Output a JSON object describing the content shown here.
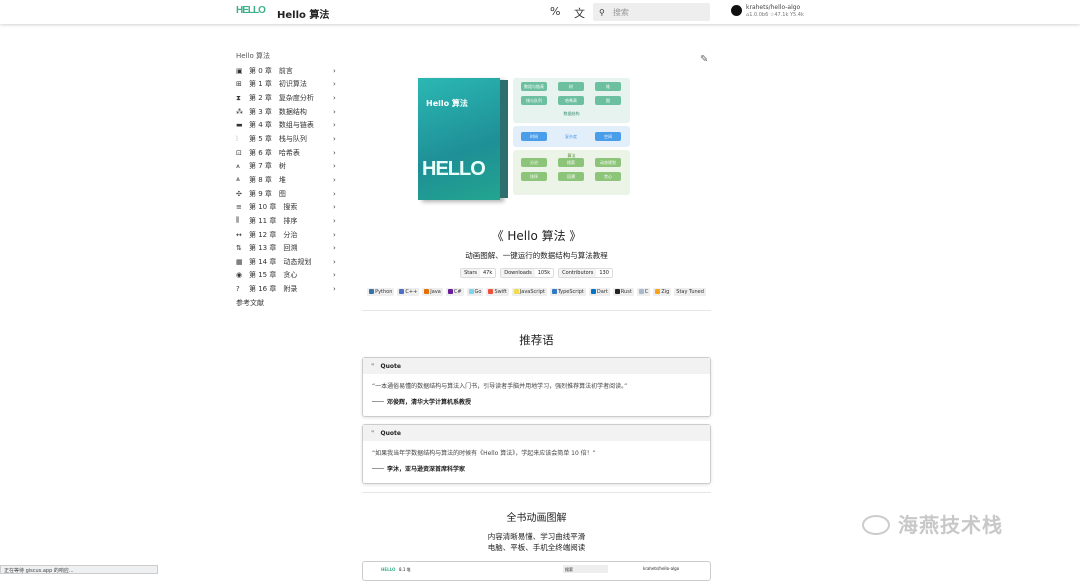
{
  "header": {
    "logo": "HELLO",
    "title": "Hello 算法",
    "search_placeholder": "搜索",
    "repo_name": "krahets/hello-algo",
    "repo_version": "1.0.0b6",
    "repo_stars": "47.1k",
    "repo_forks": "5.4k"
  },
  "sidebar": {
    "title": "Hello 算法",
    "items": [
      {
        "icon": "▣",
        "label": "第 0 章　前言"
      },
      {
        "icon": "⊞",
        "label": "第 1 章　初识算法"
      },
      {
        "icon": "⧗",
        "label": "第 2 章　复杂度分析"
      },
      {
        "icon": "⁂",
        "label": "第 3 章　数据结构"
      },
      {
        "icon": "▬",
        "label": "第 4 章　数组与链表"
      },
      {
        "icon": "⫶",
        "label": "第 5 章　栈与队列"
      },
      {
        "icon": "⊡",
        "label": "第 6 章　哈希表"
      },
      {
        "icon": "⩚",
        "label": "第 7 章　树"
      },
      {
        "icon": "⩓",
        "label": "第 8 章　堆"
      },
      {
        "icon": "✣",
        "label": "第 9 章　图"
      },
      {
        "icon": "≡",
        "label": "第 10 章　搜索"
      },
      {
        "icon": "⫼",
        "label": "第 11 章　排序"
      },
      {
        "icon": "↔",
        "label": "第 12 章　分治"
      },
      {
        "icon": "⇅",
        "label": "第 13 章　回溯"
      },
      {
        "icon": "▦",
        "label": "第 14 章　动态规划"
      },
      {
        "icon": "◉",
        "label": "第 15 章　贪心"
      },
      {
        "icon": "?",
        "label": "第 16 章　附录"
      }
    ],
    "references": "参考文献"
  },
  "cover": {
    "title": "Hello 算法",
    "art": "HELLO"
  },
  "diagram": {
    "ds_label": "数据结构",
    "ds": [
      "数组与链表",
      "树",
      "堆",
      "栈与队列",
      "哈希表",
      "图"
    ],
    "cx": [
      "时间",
      "复杂度",
      "空间"
    ],
    "algo_label": "算法",
    "algo": [
      "分治",
      "搜索",
      "动态规划",
      "排序",
      "回溯",
      "贪心"
    ]
  },
  "main": {
    "title": "《 Hello 算法 》",
    "subtitle": "动画图解、一键运行的数据结构与算法教程",
    "badges": [
      {
        "label": "Stars",
        "value": "47k"
      },
      {
        "label": "Downloads",
        "value": "105k"
      },
      {
        "label": "Contributors",
        "value": "130"
      }
    ],
    "languages": [
      {
        "n": "Python",
        "c": "#3572a5"
      },
      {
        "n": "C++",
        "c": "#4f6ec8"
      },
      {
        "n": "Java",
        "c": "#e76f00"
      },
      {
        "n": "C#",
        "c": "#6a1b9a"
      },
      {
        "n": "Go",
        "c": "#7fd5ea"
      },
      {
        "n": "Swift",
        "c": "#f05138"
      },
      {
        "n": "JavaScript",
        "c": "#f0db4f"
      },
      {
        "n": "TypeScript",
        "c": "#3178c6"
      },
      {
        "n": "Dart",
        "c": "#0175c2"
      },
      {
        "n": "Rust",
        "c": "#222"
      },
      {
        "n": "C",
        "c": "#a8b9cc"
      },
      {
        "n": "Zig",
        "c": "#f7a41d"
      },
      {
        "n": "Stay Tuned",
        "c": ""
      }
    ],
    "rec_title": "推荐语",
    "quotes": [
      {
        "head": "Quote",
        "text": "“一本通俗易懂的数据结构与算法入门书，引导读者手脑并用地学习，强烈推荐算法初学者阅读。”",
        "author": "邓俊辉，清华大学计算机系教授"
      },
      {
        "head": "Quote",
        "text": "“如果我当年学数据结构与算法的时候有《Hello 算法》，学起来应该会简单 10 倍！”",
        "author": "李沐，亚马逊资深首席科学家"
      }
    ],
    "anim_title": "全书动画图解",
    "anim_line1": "内容清晰易懂、学习曲线平滑",
    "anim_line2": "电脑、平板、手机全终端阅读",
    "preview_title": "8.1 堆",
    "preview_search": "搜索",
    "preview_repo": "krahets/hello-algo"
  },
  "status": "正在等待 giscus.app 的响应...",
  "watermark": "海燕技术栈"
}
